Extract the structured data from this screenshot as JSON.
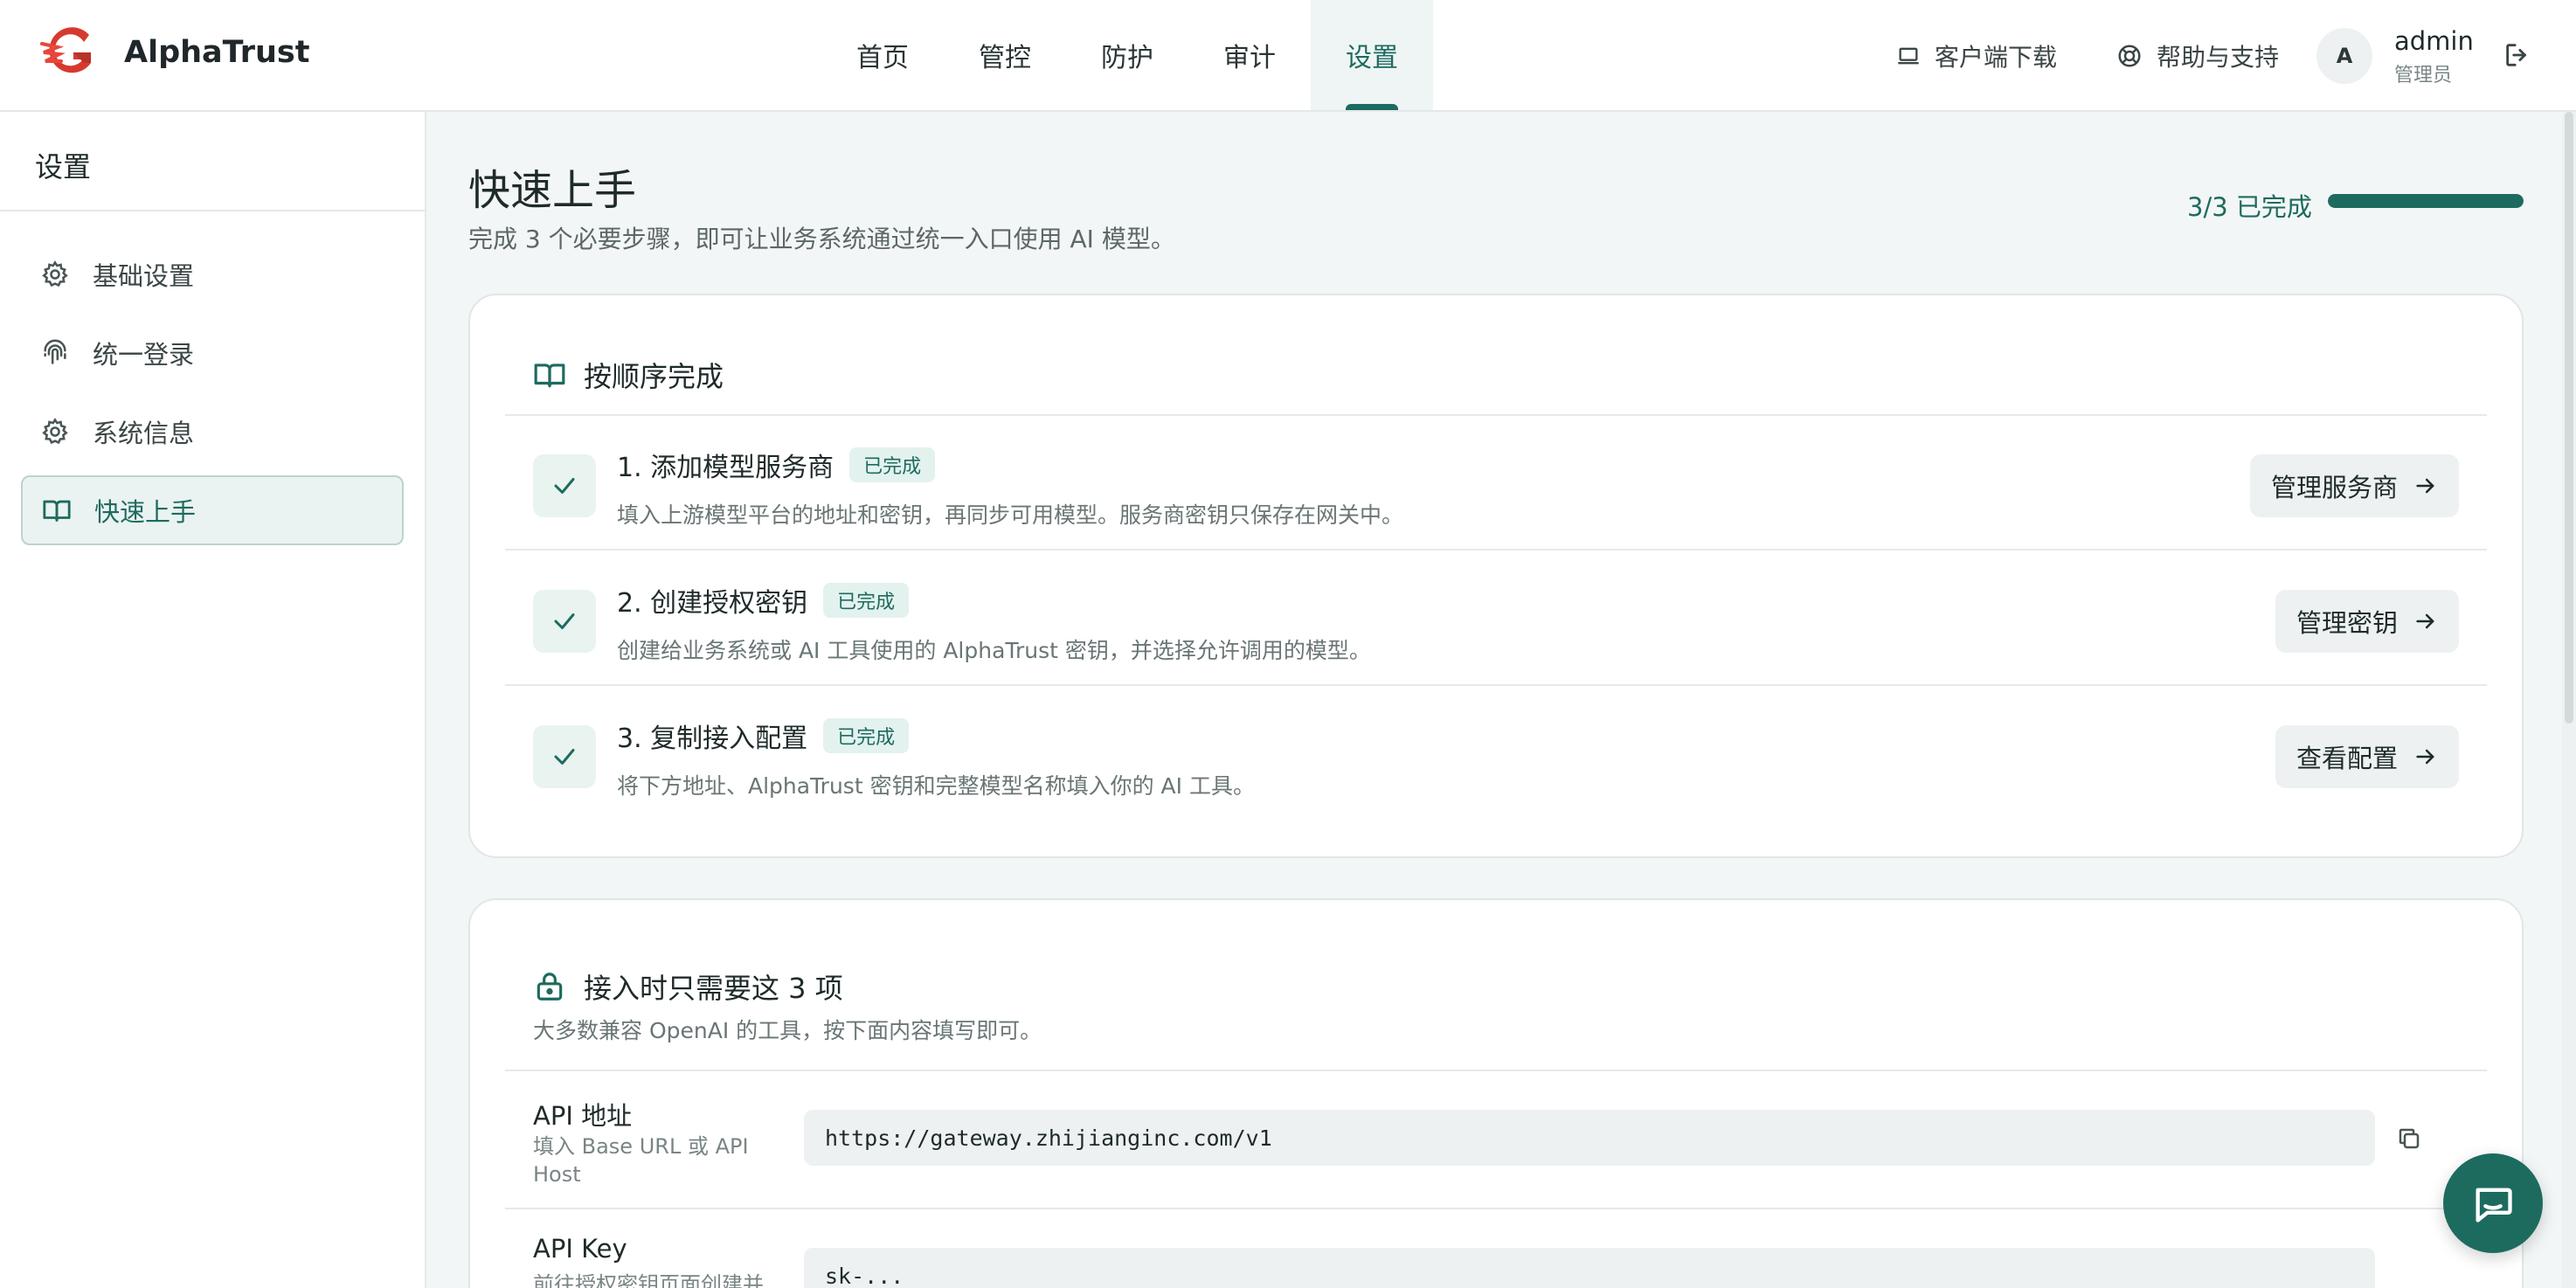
{
  "brand": {
    "name": "AlphaTrust"
  },
  "nav": [
    {
      "label": "首页"
    },
    {
      "label": "管控"
    },
    {
      "label": "防护"
    },
    {
      "label": "审计"
    },
    {
      "label": "设置",
      "active": true
    }
  ],
  "header": {
    "download_label": "客户端下载",
    "help_label": "帮助与支持",
    "avatar_initial": "A",
    "user_name": "admin",
    "user_role": "管理员"
  },
  "sidebar": {
    "title": "设置",
    "items": [
      {
        "label": "基础设置",
        "icon": "gear-icon"
      },
      {
        "label": "统一登录",
        "icon": "fingerprint-icon"
      },
      {
        "label": "系统信息",
        "icon": "gear-icon"
      },
      {
        "label": "快速上手",
        "icon": "book-icon",
        "active": true
      }
    ]
  },
  "page": {
    "title": "快速上手",
    "subtitle": "完成 3 个必要步骤，即可让业务系统通过统一入口使用 AI 模型。",
    "progress_text": "3/3 已完成",
    "progress_fraction": 1.0
  },
  "steps_card": {
    "title": "按顺序完成",
    "steps": [
      {
        "title": "1. 添加模型服务商",
        "badge": "已完成",
        "desc": "填入上游模型平台的地址和密钥，再同步可用模型。服务商密钥只保存在网关中。",
        "button": "管理服务商"
      },
      {
        "title": "2. 创建授权密钥",
        "badge": "已完成",
        "desc": "创建给业务系统或 AI 工具使用的 AlphaTrust 密钥，并选择允许调用的模型。",
        "button": "管理密钥"
      },
      {
        "title": "3. 复制接入配置",
        "badge": "已完成",
        "desc": "将下方地址、AlphaTrust 密钥和完整模型名称填入你的 AI 工具。",
        "button": "查看配置"
      }
    ]
  },
  "config_card": {
    "title": "接入时只需要这 3 项",
    "subtitle": "大多数兼容 OpenAI 的工具，按下面内容填写即可。",
    "rows": [
      {
        "label": "API 地址",
        "hint": "填入 Base URL 或 API Host",
        "value": "https://gateway.zhijianginc.com/v1"
      },
      {
        "label": "API Key",
        "hint": "前往授权密钥页面创建并",
        "value": "sk-..."
      }
    ]
  },
  "colors": {
    "accent": "#1d6b5f",
    "accent_light": "#e3f2ee",
    "background": "#f3f6f6"
  }
}
